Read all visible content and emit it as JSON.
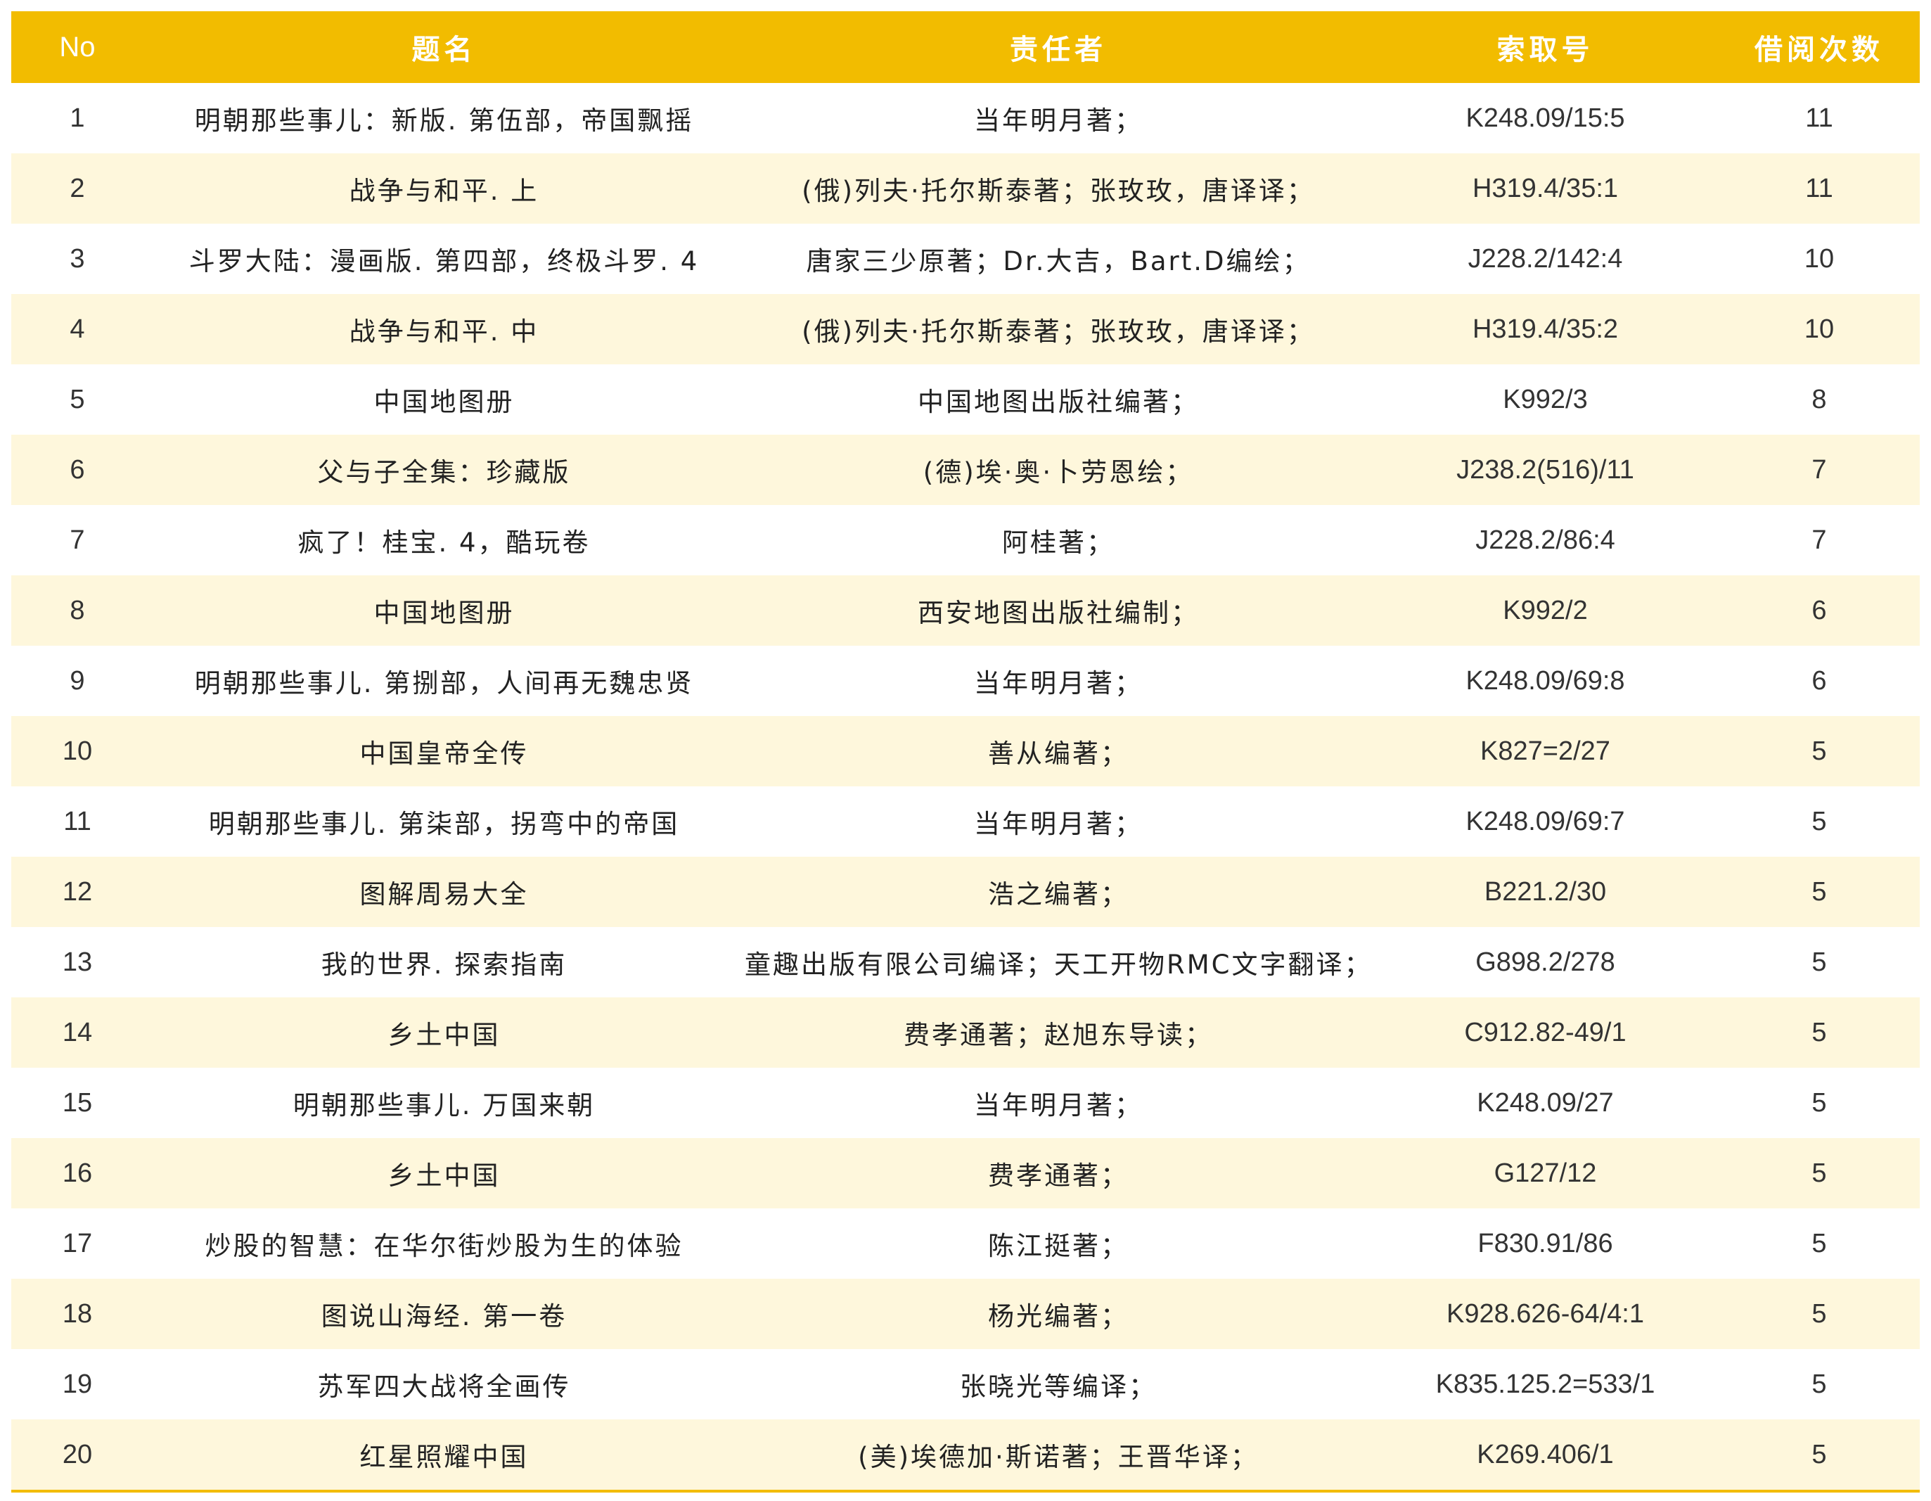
{
  "colors": {
    "header_bg": "#F2BC00",
    "stripe_bg": "#FEF7DC",
    "header_text": "#FFFFFF"
  },
  "columns": {
    "no": "No",
    "title": "题名",
    "author": "责任者",
    "call_number": "索取号",
    "borrow_count": "借阅次数"
  },
  "rows": [
    {
      "no": "1",
      "title": "明朝那些事儿：新版. 第伍部，帝国飘摇",
      "author": "当年明月著；",
      "call_number": "K248.09/15:5",
      "borrow_count": "11"
    },
    {
      "no": "2",
      "title": "战争与和平. 上",
      "author": "(俄)列夫·托尔斯泰著；张玫玫，唐译译；",
      "call_number": "H319.4/35:1",
      "borrow_count": "11"
    },
    {
      "no": "3",
      "title": "斗罗大陆：漫画版. 第四部，终极斗罗. 4",
      "author": "唐家三少原著；Dr.大吉，Bart.D编绘；",
      "call_number": "J228.2/142:4",
      "borrow_count": "10"
    },
    {
      "no": "4",
      "title": "战争与和平. 中",
      "author": "(俄)列夫·托尔斯泰著；张玫玫，唐译译；",
      "call_number": "H319.4/35:2",
      "borrow_count": "10"
    },
    {
      "no": "5",
      "title": "中国地图册",
      "author": "中国地图出版社编著；",
      "call_number": "K992/3",
      "borrow_count": "8"
    },
    {
      "no": "6",
      "title": "父与子全集：珍藏版",
      "author": "(德)埃·奥·卜劳恩绘；",
      "call_number": "J238.2(516)/11",
      "borrow_count": "7"
    },
    {
      "no": "7",
      "title": "疯了！桂宝. 4，酷玩卷",
      "author": "阿桂著；",
      "call_number": "J228.2/86:4",
      "borrow_count": "7"
    },
    {
      "no": "8",
      "title": "中国地图册",
      "author": "西安地图出版社编制；",
      "call_number": "K992/2",
      "borrow_count": "6"
    },
    {
      "no": "9",
      "title": "明朝那些事儿. 第捌部，人间再无魏忠贤",
      "author": "当年明月著；",
      "call_number": "K248.09/69:8",
      "borrow_count": "6"
    },
    {
      "no": "10",
      "title": "中国皇帝全传",
      "author": "善从编著；",
      "call_number": "K827=2/27",
      "borrow_count": "5"
    },
    {
      "no": "11",
      "title": "明朝那些事儿. 第柒部，拐弯中的帝国",
      "author": "当年明月著；",
      "call_number": "K248.09/69:7",
      "borrow_count": "5"
    },
    {
      "no": "12",
      "title": "图解周易大全",
      "author": "浩之编著；",
      "call_number": "B221.2/30",
      "borrow_count": "5"
    },
    {
      "no": "13",
      "title": "我的世界. 探索指南",
      "author": "童趣出版有限公司编译；天工开物RMC文字翻译；",
      "call_number": "G898.2/278",
      "borrow_count": "5"
    },
    {
      "no": "14",
      "title": "乡土中国",
      "author": "费孝通著；赵旭东导读；",
      "call_number": "C912.82-49/1",
      "borrow_count": "5"
    },
    {
      "no": "15",
      "title": "明朝那些事儿. 万国来朝",
      "author": "当年明月著；",
      "call_number": "K248.09/27",
      "borrow_count": "5"
    },
    {
      "no": "16",
      "title": "乡土中国",
      "author": "费孝通著；",
      "call_number": "G127/12",
      "borrow_count": "5"
    },
    {
      "no": "17",
      "title": "炒股的智慧：在华尔街炒股为生的体验",
      "author": "陈江挺著；",
      "call_number": "F830.91/86",
      "borrow_count": "5"
    },
    {
      "no": "18",
      "title": "图说山海经. 第一卷",
      "author": "杨光编著；",
      "call_number": "K928.626-64/4:1",
      "borrow_count": "5"
    },
    {
      "no": "19",
      "title": "苏军四大战将全画传",
      "author": "张晓光等编译；",
      "call_number": "K835.125.2=533/1",
      "borrow_count": "5"
    },
    {
      "no": "20",
      "title": "红星照耀中国",
      "author": "(美)埃德加·斯诺著；王晋华译；",
      "call_number": "K269.406/1",
      "borrow_count": "5"
    }
  ]
}
